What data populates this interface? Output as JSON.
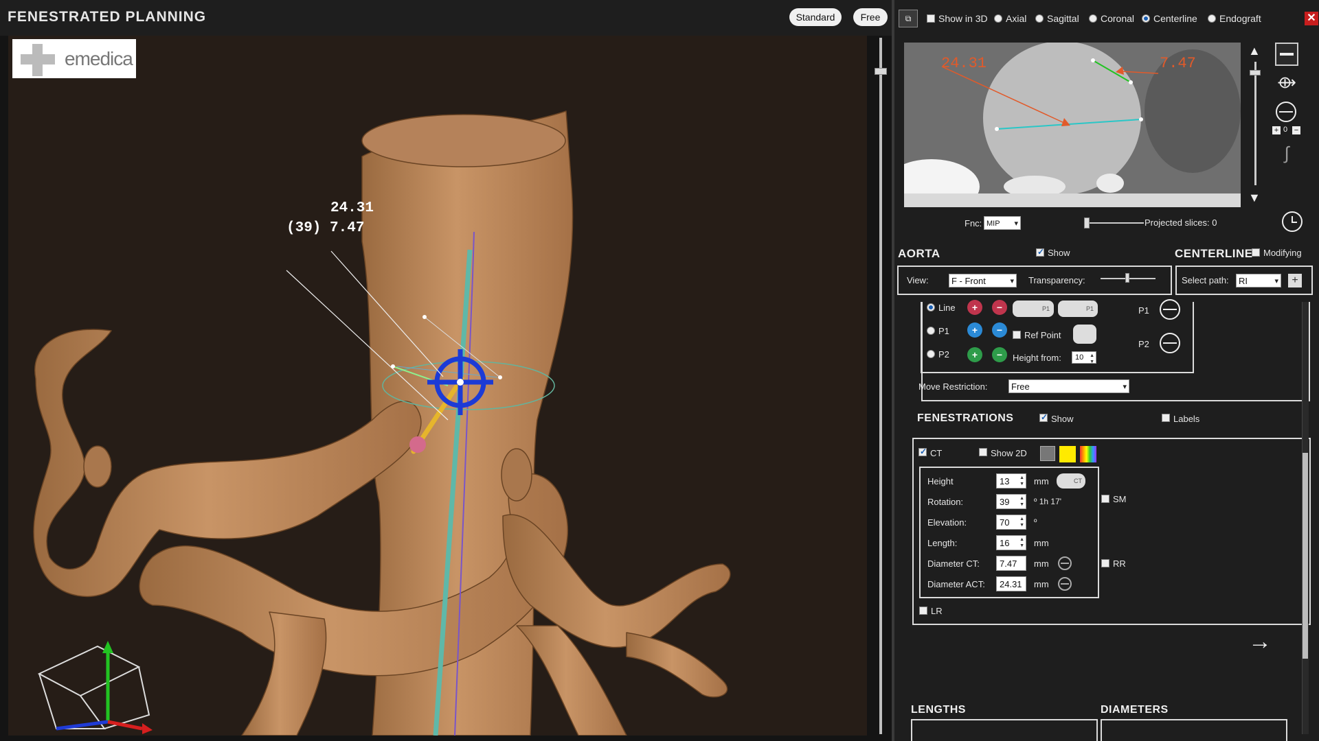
{
  "app": {
    "title": "FENESTRATED PLANNING"
  },
  "mode_buttons": {
    "standard": "Standard",
    "free": "Free"
  },
  "logo": {
    "text": "emedica"
  },
  "viewport": {
    "measure_top": "24.31",
    "measure_bottom": "(39) 7.47"
  },
  "view_options": {
    "show3d": "Show in 3D",
    "axial": "Axial",
    "sagittal": "Sagittal",
    "coronal": "Coronal",
    "centerline": "Centerline",
    "endograft": "Endograft",
    "selected": "Centerline"
  },
  "ct": {
    "label_left": "24.31",
    "label_right": "7.47",
    "fnc_label": "Fnc:",
    "fnc_value": "MIP",
    "projected_label": "Projected slices: 0",
    "zoom_value": "0"
  },
  "aorta": {
    "title": "AORTA",
    "show_label": "Show",
    "view_label": "View:",
    "view_value": "F - Front",
    "transparency_label": "Transparency:"
  },
  "centerline": {
    "title": "CENTERLINE",
    "modifying_label": "Modifying",
    "select_path_label": "Select path:",
    "select_path_value": "RI"
  },
  "points": {
    "line": "Line",
    "p1": "P1",
    "p2": "P2",
    "p1_tag": "P1",
    "ref_point": "Ref Point",
    "height_from_label": "Height from:",
    "height_from_value": "10",
    "p1_right": "P1",
    "p2_right": "P2",
    "move_restriction_label": "Move Restriction:",
    "move_restriction_value": "Free"
  },
  "fenestrations": {
    "title": "FENESTRATIONS",
    "show_label": "Show",
    "labels_label": "Labels",
    "ct_label": "CT",
    "show2d_label": "Show 2D",
    "ct_button": "CT",
    "height_label": "Height",
    "height_value": "13",
    "height_unit": "mm",
    "rotation_label": "Rotation:",
    "rotation_value": "39",
    "rotation_unit": "º 1h 17'",
    "elevation_label": "Elevation:",
    "elevation_value": "70",
    "elevation_unit": "º",
    "length_label": "Length:",
    "length_value": "16",
    "length_unit": "mm",
    "diam_ct_label": "Diameter CT:",
    "diam_ct_value": "7.47",
    "diam_ct_unit": "mm",
    "diam_act_label": "Diameter ACT:",
    "diam_act_value": "24.31",
    "diam_act_unit": "mm",
    "sm": "SM",
    "rr": "RR",
    "lr": "LR",
    "colors": {
      "yellow": "#ffea00",
      "gradient": "rainbow"
    }
  },
  "bottom": {
    "lengths": "LENGTHS",
    "diameters": "DIAMETERS"
  },
  "icons": [
    "close-icon",
    "3d-toggle-icon",
    "arrow-up-icon",
    "arrow-down-icon",
    "minus-bar-icon",
    "branch-icon",
    "diameter-icon",
    "curve-icon",
    "clock-icon",
    "next-arrow-icon"
  ]
}
